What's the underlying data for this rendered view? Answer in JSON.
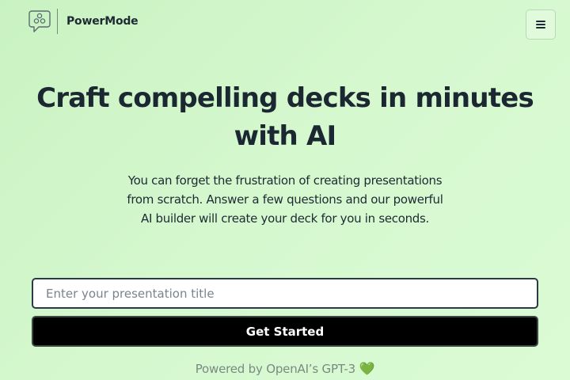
{
  "header": {
    "brand_name": "PowerMode",
    "logo_icon": "chat-bubble-nodes-icon",
    "menu_icon": "hamburger-icon"
  },
  "hero": {
    "title": "Craft compelling decks in minutes with AI",
    "subtitle": "You can forget the frustration of creating presentations from scratch. Answer a few questions and our powerful AI builder will create your deck for you in seconds."
  },
  "form": {
    "title_input_value": "",
    "title_input_placeholder": "Enter your presentation title",
    "submit_label": "Get Started"
  },
  "footer": {
    "powered_by": "Powered by OpenAI’s GPT-3",
    "heart": "💚"
  },
  "colors": {
    "background": "#d3f6cc",
    "button_bg": "#000000",
    "button_text": "#ffffff",
    "heading_text": "#1b2731",
    "muted_text": "#7a8a82",
    "heart": "#3fb53f"
  }
}
